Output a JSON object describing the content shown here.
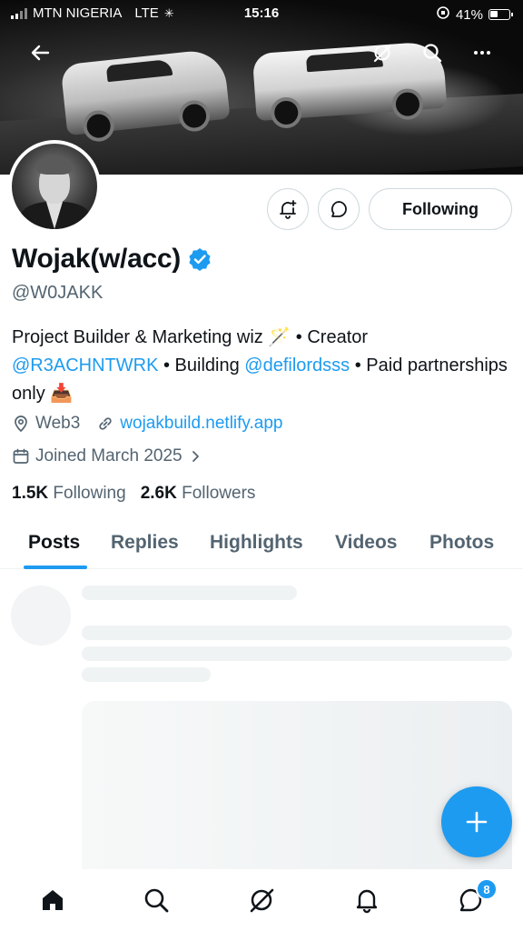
{
  "status_bar": {
    "carrier": "MTN NIGERIA",
    "network": "LTE",
    "time": "15:16",
    "battery": "41%"
  },
  "header": {
    "back_icon": "arrow-left-icon",
    "grok_icon": "grok-icon",
    "search_icon": "search-icon",
    "more_icon": "more-icon"
  },
  "profile": {
    "display_name": "Wojak(w/acc)",
    "handle": "@W0JAKK",
    "verified": true,
    "bio": {
      "part1": "Project Builder & Marketing wiz 🪄 • Creator",
      "mention1": "@R3ACHNTWRK",
      "part2": " • Building ",
      "mention2": "@defilordsss",
      "part3": " • Paid partnerships only 📥"
    },
    "location": "Web3",
    "website": "wojakbuild.netlify.app",
    "joined": "Joined March 2025",
    "following_count": "1.5K",
    "following_label": "Following",
    "followers_count": "2.6K",
    "followers_label": "Followers"
  },
  "actions": {
    "follow_button_label": "Following"
  },
  "tabs": [
    {
      "label": "Posts",
      "active": true
    },
    {
      "label": "Replies",
      "active": false
    },
    {
      "label": "Highlights",
      "active": false
    },
    {
      "label": "Videos",
      "active": false
    },
    {
      "label": "Photos",
      "active": false
    }
  ],
  "bottom_nav": {
    "items": [
      "home-icon",
      "search-icon",
      "grok-icon",
      "bell-icon",
      "messages-icon"
    ],
    "messages_badge": "8"
  },
  "colors": {
    "accent": "#1d9bf0",
    "text": "#0f1419",
    "muted": "#536471",
    "border": "#cfd9de"
  }
}
